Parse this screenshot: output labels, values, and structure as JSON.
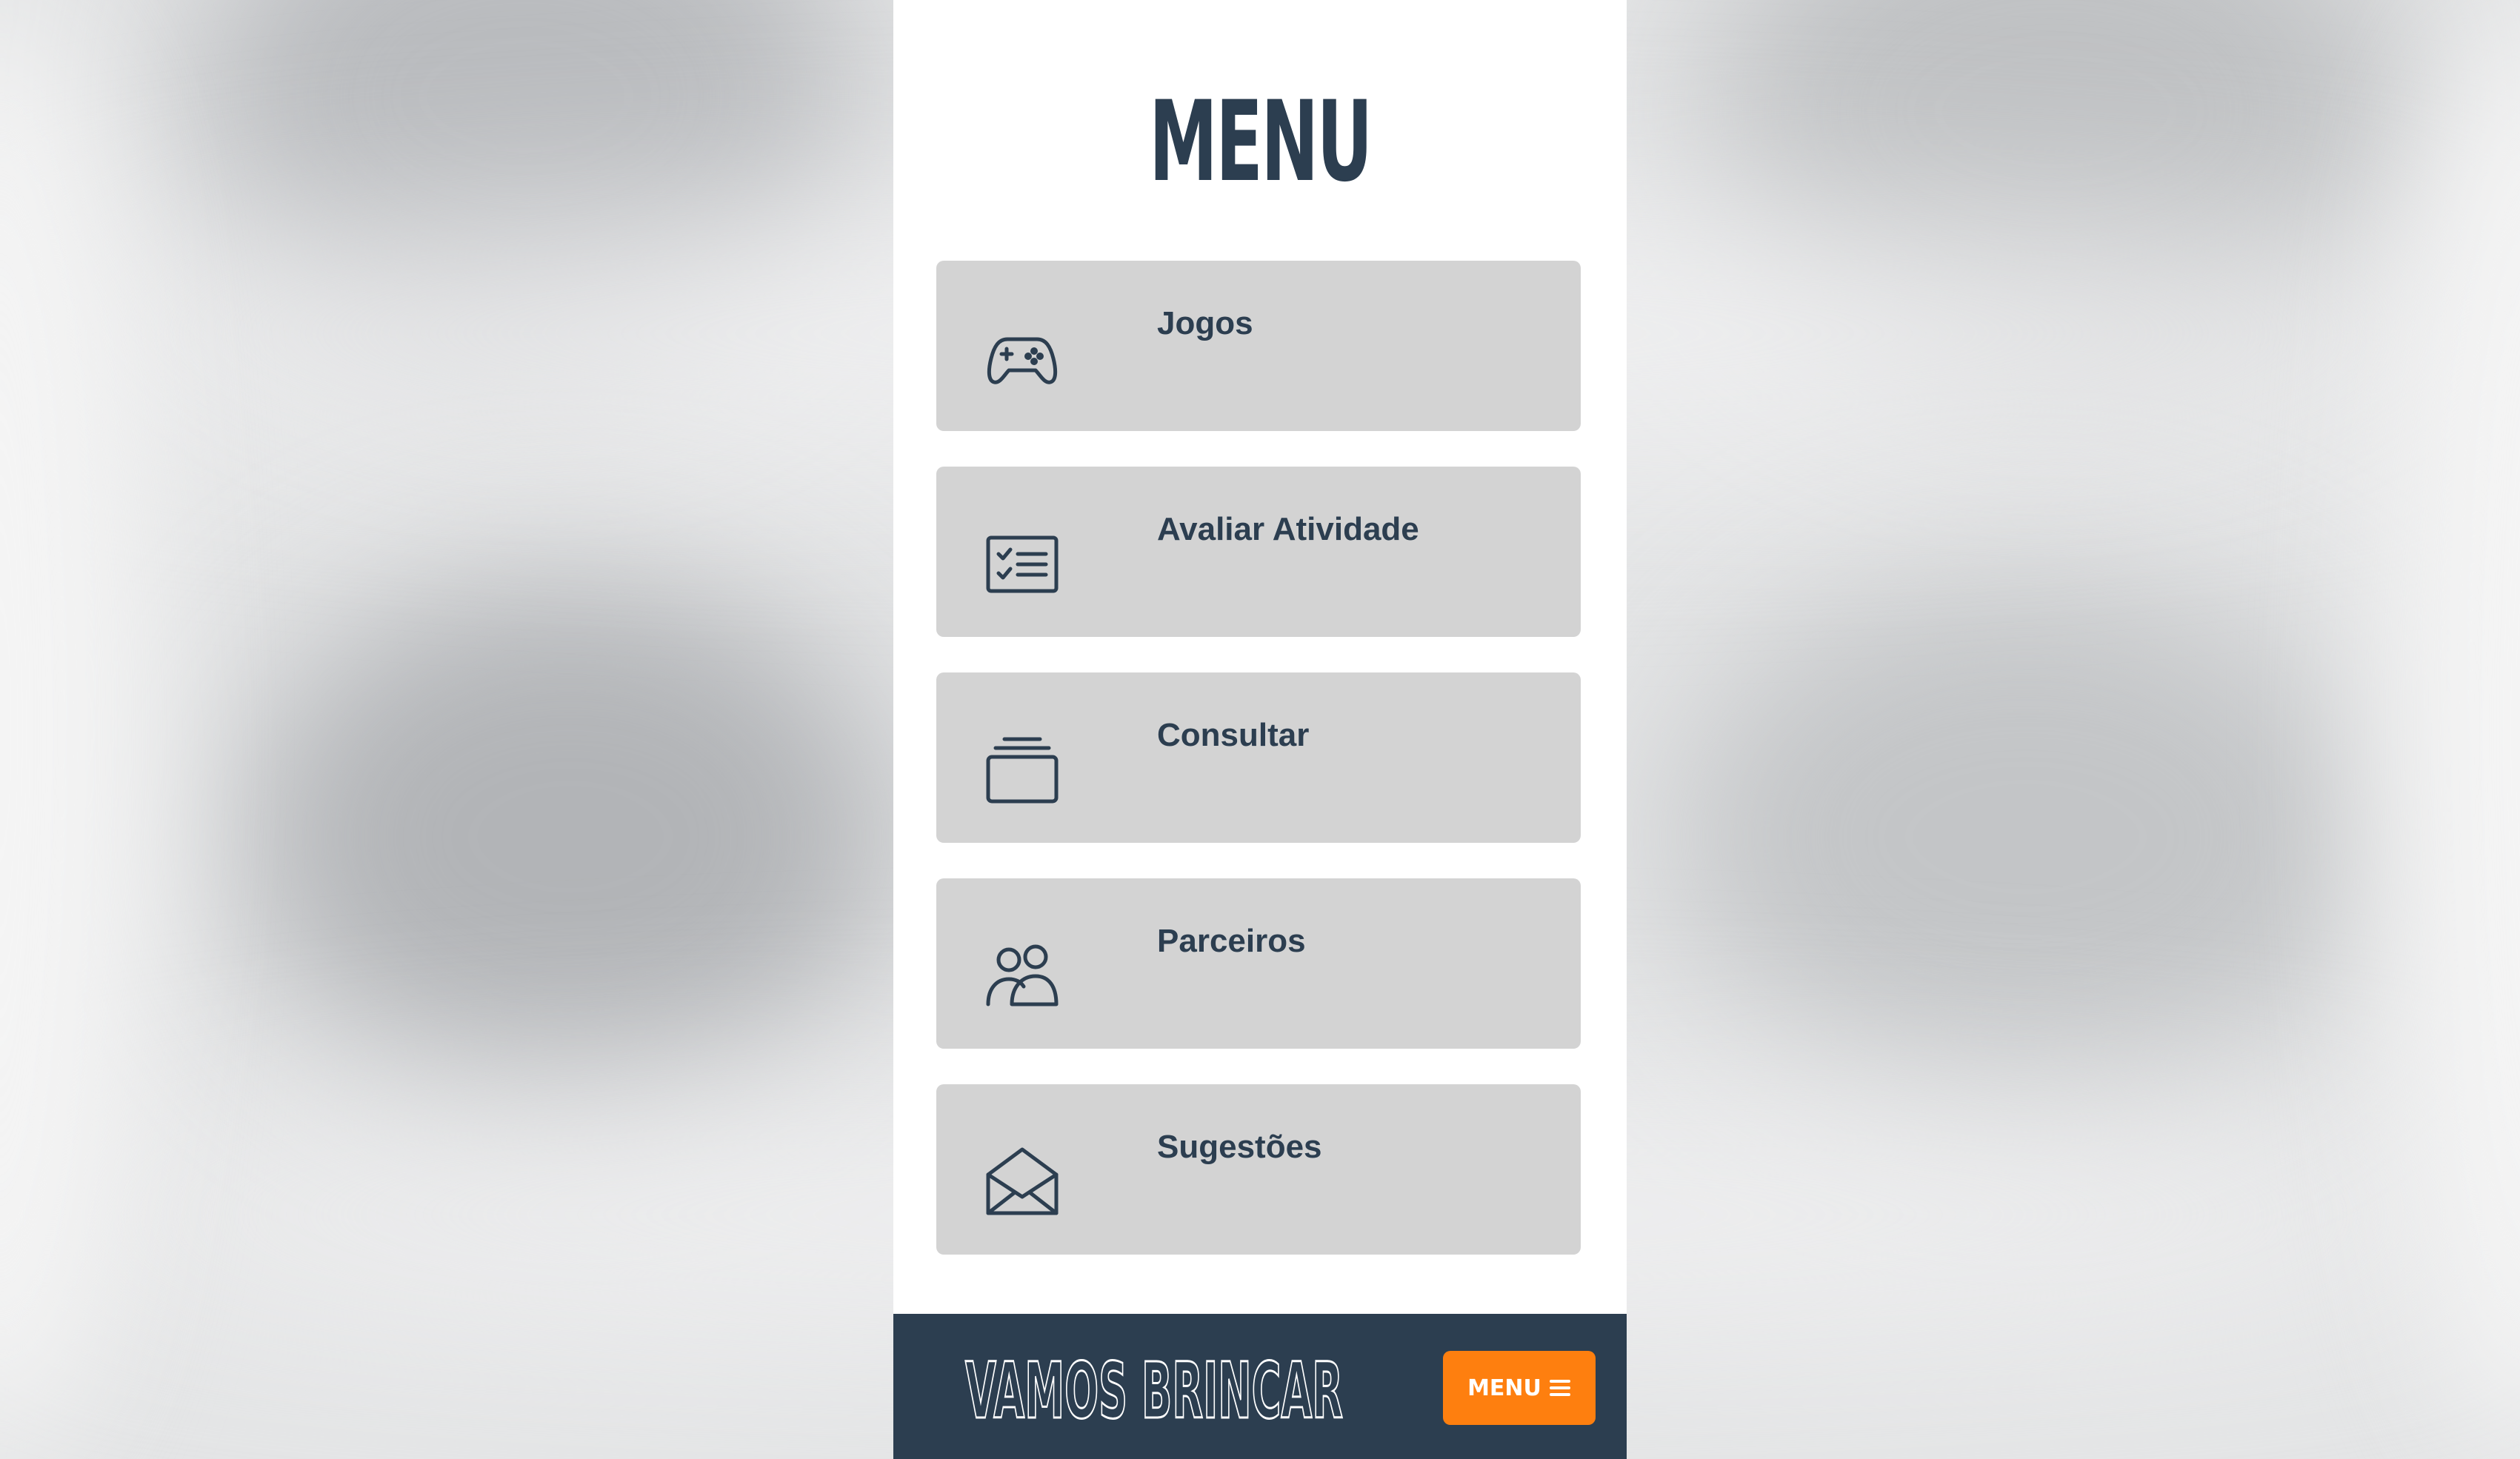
{
  "page": {
    "title": "MENU"
  },
  "menu": {
    "items": [
      {
        "label": "Jogos",
        "icon": "gamepad-icon"
      },
      {
        "label": "Avaliar Atividade",
        "icon": "checklist-icon"
      },
      {
        "label": "Consultar",
        "icon": "card-stack-icon"
      },
      {
        "label": "Parceiros",
        "icon": "users-icon"
      },
      {
        "label": "Sugestões",
        "icon": "open-envelope-icon"
      }
    ]
  },
  "footer": {
    "brand": "VAMOS BRINCAR",
    "menu_button_label": "MENU",
    "menu_button_icon": "hamburger-icon"
  },
  "colors": {
    "primary_dark": "#2c3e50",
    "item_background": "#d3d3d3",
    "accent_orange": "#fe7f0f",
    "page_background": "#ffffff"
  }
}
